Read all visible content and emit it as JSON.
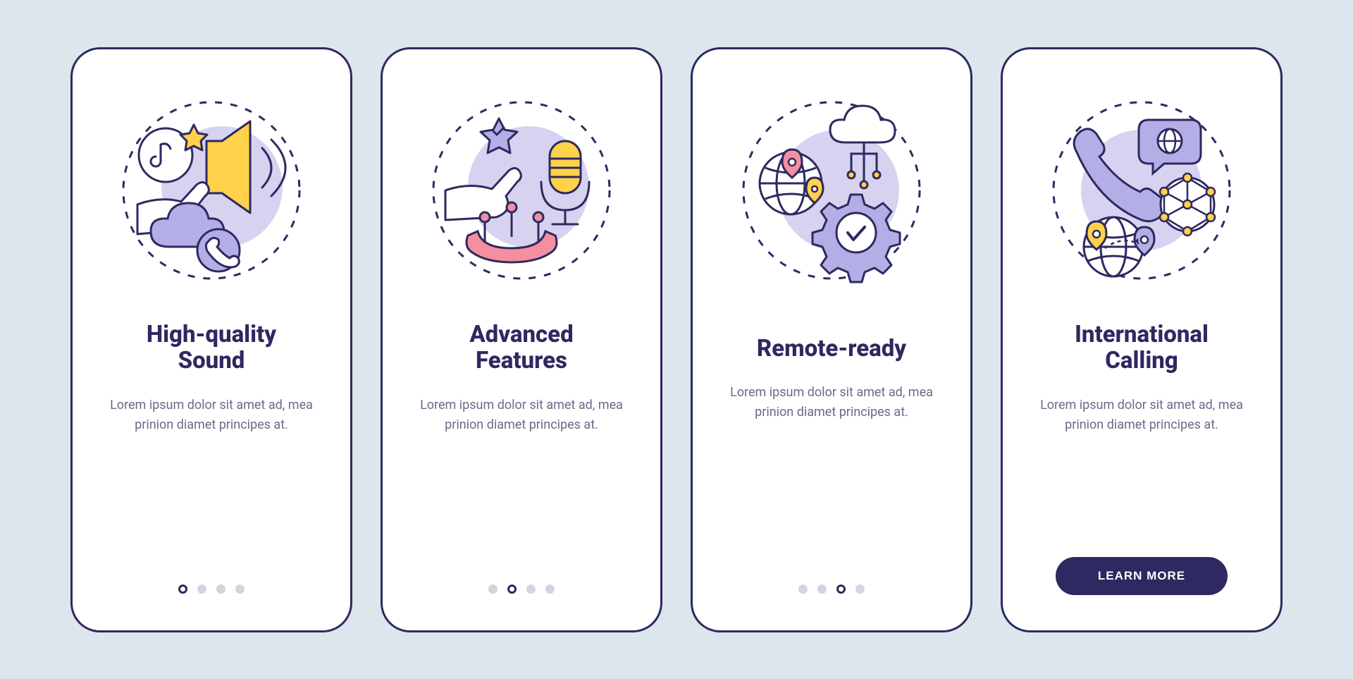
{
  "colors": {
    "ink": "#2e2960",
    "accentYellow": "#ffd24a",
    "accentPurple": "#b3aee6",
    "accentPink": "#f48fa0",
    "bgPurple": "#d6d2f0",
    "muted": "#6a6a8a"
  },
  "screens": [
    {
      "id": "sound",
      "title": "High-quality\nSound",
      "description": "Lorem ipsum dolor sit amet ad, mea prinion diamet principes at.",
      "activeIndex": 0,
      "hasButton": false
    },
    {
      "id": "features",
      "title": "Advanced\nFeatures",
      "description": "Lorem ipsum dolor sit amet ad, mea prinion diamet principes at.",
      "activeIndex": 1,
      "hasButton": false
    },
    {
      "id": "remote",
      "title": "Remote-ready",
      "description": "Lorem ipsum dolor sit amet ad, mea prinion diamet principes at.",
      "activeIndex": 2,
      "hasButton": false
    },
    {
      "id": "international",
      "title": "International\nCalling",
      "description": "Lorem ipsum dolor sit amet ad, mea prinion diamet principes at.",
      "activeIndex": 3,
      "hasButton": true
    }
  ],
  "totalDots": 4,
  "buttonLabel": "LEARN MORE"
}
